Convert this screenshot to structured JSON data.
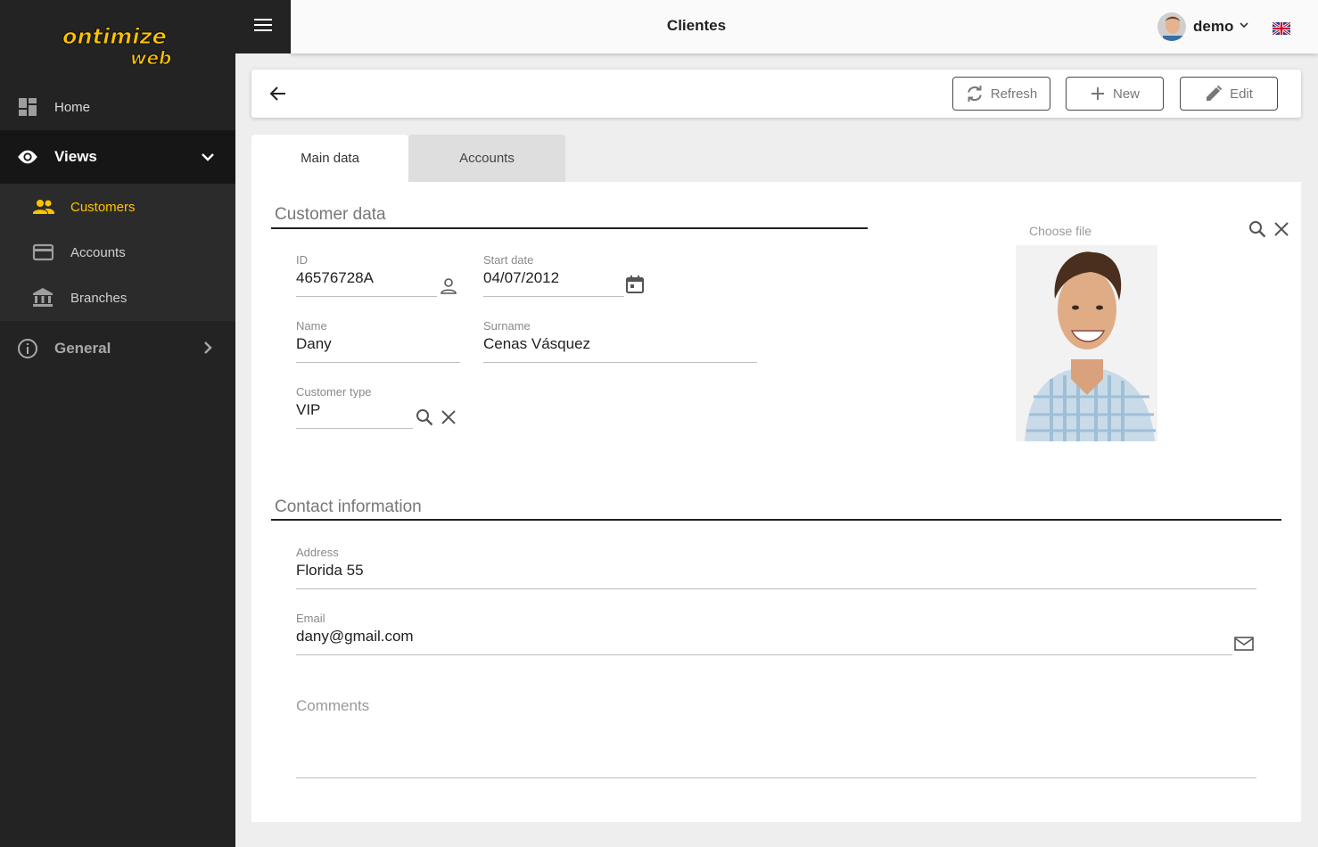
{
  "app": {
    "logo_main": "ontimize",
    "logo_sub": "web",
    "page_title": "Clientes"
  },
  "sidebar": {
    "home": "Home",
    "views": "Views",
    "sub_items": [
      {
        "label": "Customers",
        "icon": "people-icon",
        "active": true
      },
      {
        "label": "Accounts",
        "icon": "credit-card-icon",
        "active": false
      },
      {
        "label": "Branches",
        "icon": "bank-icon",
        "active": false
      }
    ],
    "general": "General"
  },
  "user": {
    "name": "demo",
    "language_flag": "uk-flag-icon"
  },
  "toolbar": {
    "refresh_label": "Refresh",
    "new_label": "New",
    "edit_label": "Edit"
  },
  "tabs": [
    {
      "label": "Main data",
      "active": true
    },
    {
      "label": "Accounts",
      "active": false
    }
  ],
  "customer": {
    "section_title": "Customer data",
    "id_label": "ID",
    "id_value": "46576728A",
    "start_date_label": "Start date",
    "start_date_value": "04/07/2012",
    "name_label": "Name",
    "name_value": "Dany",
    "surname_label": "Surname",
    "surname_value": "Cenas Vásquez",
    "type_label": "Customer type",
    "type_value": "VIP",
    "choose_file": "Choose file"
  },
  "contact": {
    "section_title": "Contact information",
    "address_label": "Address",
    "address_value": "Florida 55",
    "email_label": "Email",
    "email_value": "dany@gmail.com",
    "comments_placeholder": "Comments"
  },
  "colors": {
    "accent": "#ffc200",
    "sidebar_bg": "#232323",
    "active_section_bg": "#161616"
  }
}
